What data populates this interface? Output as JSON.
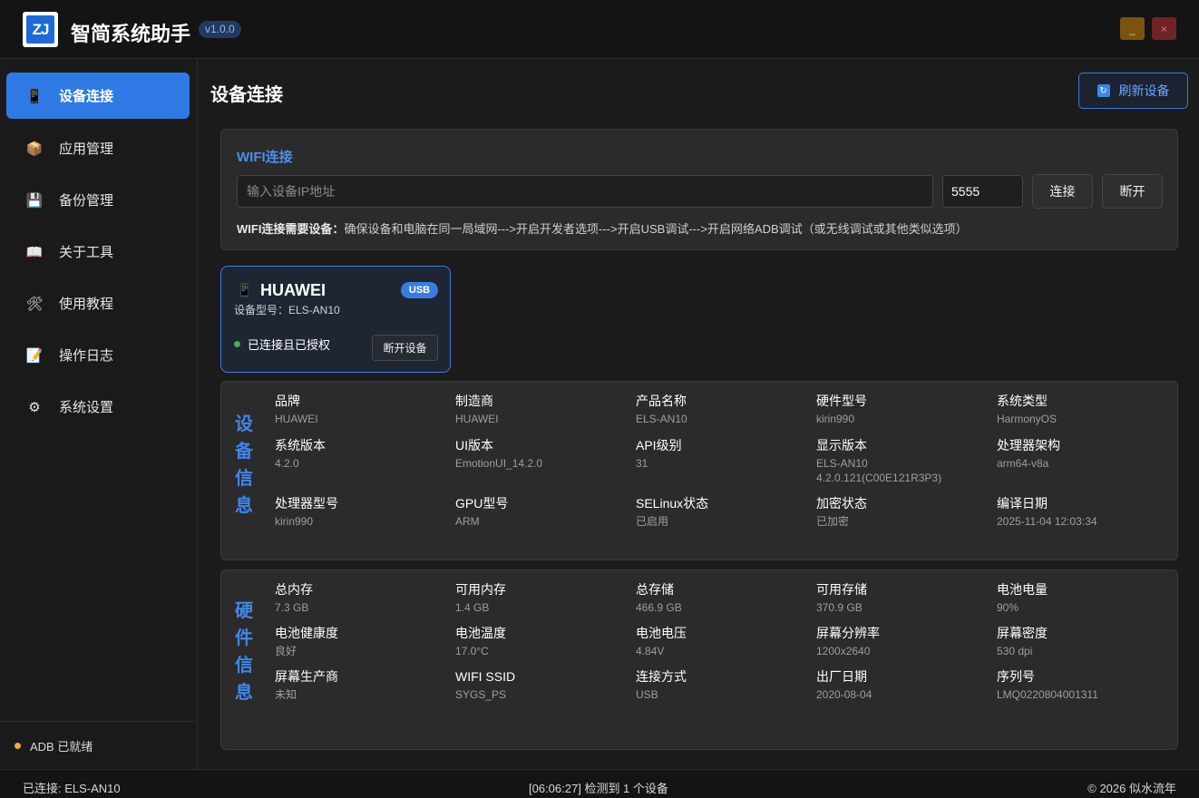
{
  "app": {
    "logo_text": "ZJ",
    "title": "智简系统助手",
    "version": "v1.0.0",
    "minimize_glyph": "_",
    "close_glyph": "×"
  },
  "sidebar": {
    "items": [
      {
        "label": "设备连接",
        "icon": "phone-icon",
        "glyph": "📱",
        "active": true
      },
      {
        "label": "应用管理",
        "icon": "package-icon",
        "glyph": "📦",
        "active": false
      },
      {
        "label": "备份管理",
        "icon": "floppy-disk-icon",
        "glyph": "💾",
        "active": false
      },
      {
        "label": "关于工具",
        "icon": "book-icon",
        "glyph": "📖",
        "active": false
      },
      {
        "label": "使用教程",
        "icon": "tools-icon",
        "glyph": "🛠",
        "active": false
      },
      {
        "label": "操作日志",
        "icon": "memo-icon",
        "glyph": "📝",
        "active": false
      },
      {
        "label": "系统设置",
        "icon": "gear-icon",
        "glyph": "⚙",
        "active": false
      }
    ],
    "footer": "ADB 已就绪"
  },
  "main": {
    "title": "设备连接",
    "refresh_label": "刷新设备"
  },
  "wifi": {
    "title": "WIFI连接",
    "ip_placeholder": "输入设备IP地址",
    "ip_value": "",
    "port_value": "5555",
    "connect_label": "连接",
    "disconnect_label": "断开",
    "hint_title": "WIFI连接需要设备：",
    "hint_text": "确保设备和电脑在同一局域网--->开启开发者选项--->开启USB调试--->开启网络ADB调试（或无线调试或其他类似选项）"
  },
  "device_card": {
    "name": "HUAWEI",
    "badge": "USB",
    "model": "设备型号：ELS-AN10",
    "status": "已连接且已授权",
    "disconnect_label": "断开设备"
  },
  "device_info": {
    "section_title": [
      "设",
      "备",
      "信",
      "息"
    ],
    "fields": [
      {
        "label": "品牌",
        "value": "HUAWEI"
      },
      {
        "label": "制造商",
        "value": "HUAWEI"
      },
      {
        "label": "产品名称",
        "value": "ELS-AN10"
      },
      {
        "label": "硬件型号",
        "value": "kirin990"
      },
      {
        "label": "系统类型",
        "value": "HarmonyOS"
      },
      {
        "label": "系统版本",
        "value": "4.2.0"
      },
      {
        "label": "UI版本",
        "value": "EmotionUI_14.2.0"
      },
      {
        "label": "API级别",
        "value": "31"
      },
      {
        "label": "显示版本",
        "value": "ELS-AN10\n4.2.0.121(C00E121R3P3)"
      },
      {
        "label": "处理器架构",
        "value": "arm64-v8a"
      },
      {
        "label": "处理器型号",
        "value": "kirin990"
      },
      {
        "label": "GPU型号",
        "value": "ARM"
      },
      {
        "label": "SELinux状态",
        "value": "已启用"
      },
      {
        "label": "加密状态",
        "value": "已加密"
      },
      {
        "label": "编译日期",
        "value": "2025-11-04 12:03:34"
      }
    ]
  },
  "hardware_info": {
    "section_title": [
      "硬",
      "件",
      "信",
      "息"
    ],
    "fields": [
      {
        "label": "总内存",
        "value": "7.3 GB"
      },
      {
        "label": "可用内存",
        "value": "1.4 GB"
      },
      {
        "label": "总存储",
        "value": "466.9 GB"
      },
      {
        "label": "可用存储",
        "value": "370.9 GB"
      },
      {
        "label": "电池电量",
        "value": "90%"
      },
      {
        "label": "电池健康度",
        "value": "良好"
      },
      {
        "label": "电池温度",
        "value": "17.0°C"
      },
      {
        "label": "电池电压",
        "value": "4.84V"
      },
      {
        "label": "屏幕分辨率",
        "value": "1200x2640"
      },
      {
        "label": "屏幕密度",
        "value": "530 dpi"
      },
      {
        "label": "屏幕生产商",
        "value": "未知"
      },
      {
        "label": "WIFI SSID",
        "value": "SYGS_PS"
      },
      {
        "label": "连接方式",
        "value": "USB"
      },
      {
        "label": "出厂日期",
        "value": "2020-08-04"
      },
      {
        "label": "序列号",
        "value": "LMQ0220804001311"
      }
    ]
  },
  "statusbar": {
    "left": "已连接: ELS-AN10",
    "center": "[06:06:27] 检测到 1 个设备",
    "right": "© 2026 似水流年"
  },
  "colors": {
    "accent": "#2f7ae5",
    "background": "#1b1b1b",
    "panel": "#2b2b2b",
    "status_ok": "#3bb54a",
    "status_warn": "#e6b12d"
  }
}
